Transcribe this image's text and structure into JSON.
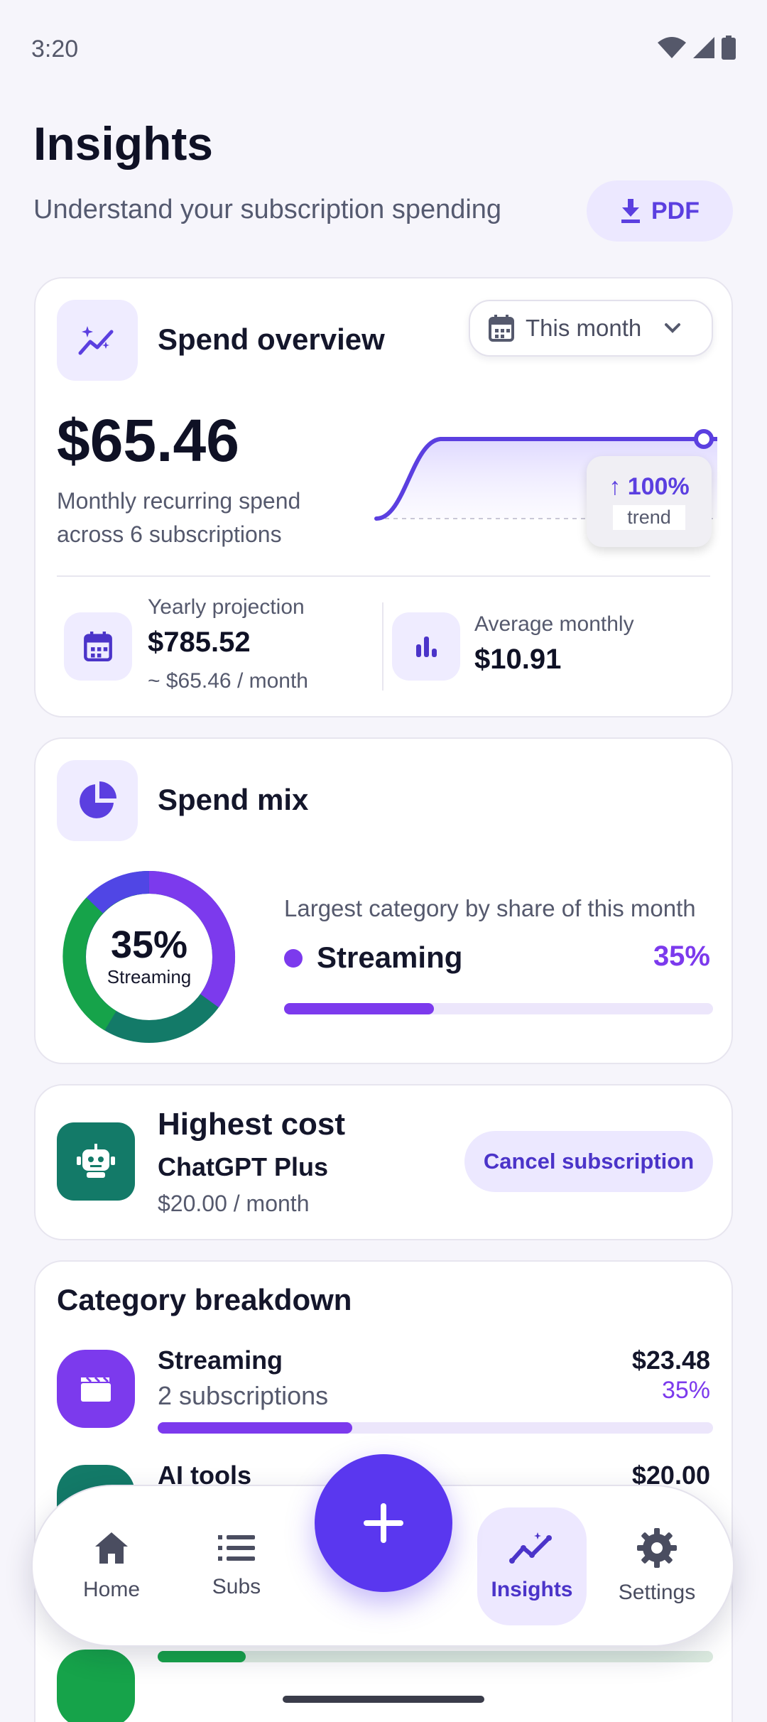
{
  "status_bar": {
    "time": "3:20"
  },
  "header": {
    "title": "Insights",
    "subtitle": "Understand your subscription spending",
    "pdf_label": "PDF"
  },
  "overview": {
    "title": "Spend overview",
    "period": "This month",
    "amount": "$65.46",
    "caption": "Monthly recurring spend across 6 subscriptions",
    "trend_value": "↑ 100%",
    "trend_label": "trend",
    "yearly_label": "Yearly projection",
    "yearly_value": "$785.52",
    "yearly_sub": "~ $65.46 / month",
    "avg_label": "Average monthly",
    "avg_value": "$10.91"
  },
  "mix": {
    "title": "Spend mix",
    "donut_pct": "35%",
    "donut_category": "Streaming",
    "caption": "Largest category by share of this month",
    "top_category": "Streaming",
    "top_pct": "35%",
    "top_share": 0.35,
    "accent": "#7c3aed"
  },
  "highest": {
    "title": "Highest cost",
    "name": "ChatGPT Plus",
    "price": "$20.00 / month",
    "cancel_label": "Cancel subscription"
  },
  "breakdown": {
    "title": "Category breakdown",
    "items": [
      {
        "name": "Streaming",
        "count": "2 subscriptions",
        "amount": "$23.48",
        "pct": "35%",
        "share": 0.35,
        "color": "#7c3aed"
      },
      {
        "name": "AI tools",
        "amount": "$20.00",
        "share": 0.31,
        "color": "#137a68"
      }
    ]
  },
  "nav": {
    "items": [
      {
        "label": "Home",
        "icon": "home-icon"
      },
      {
        "label": "Subs",
        "icon": "list-icon"
      },
      {
        "label": "Insights",
        "icon": "insights-icon",
        "active": true
      },
      {
        "label": "Settings",
        "icon": "gear-icon"
      }
    ],
    "fab_icon": "plus-icon"
  }
}
